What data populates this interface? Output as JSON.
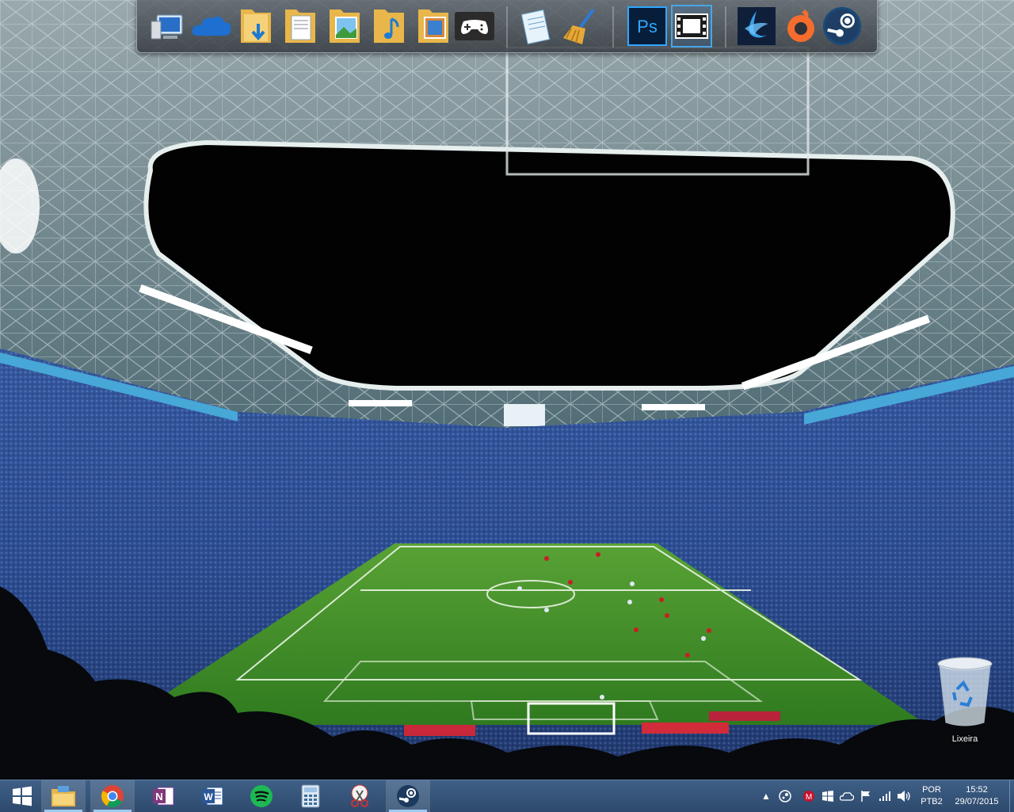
{
  "desktop": {
    "wallpaper": "stadium-night-icon",
    "recycle_bin_label": "Lixeira"
  },
  "dock": {
    "items": [
      {
        "name": "computer-icon"
      },
      {
        "name": "onedrive-cloud-icon"
      },
      {
        "name": "downloads-folder-icon"
      },
      {
        "name": "documents-folder-icon"
      },
      {
        "name": "pictures-folder-icon"
      },
      {
        "name": "music-folder-icon"
      },
      {
        "name": "videos-folder-icon"
      },
      {
        "name": "gamepad-icon"
      },
      {
        "name": "notepad-icon"
      },
      {
        "name": "ccleaner-broom-icon"
      },
      {
        "name": "photoshop-icon",
        "text": "Ps"
      },
      {
        "name": "video-editor-film-icon"
      },
      {
        "name": "battle-net-icon"
      },
      {
        "name": "origin-icon"
      },
      {
        "name": "steam-icon"
      }
    ]
  },
  "taskbar": {
    "pinned": [
      {
        "name": "start-button"
      },
      {
        "name": "file-explorer-icon"
      },
      {
        "name": "chrome-icon"
      },
      {
        "name": "onenote-icon",
        "text": "N"
      },
      {
        "name": "word-icon",
        "text": "W"
      },
      {
        "name": "spotify-icon"
      },
      {
        "name": "calculator-icon"
      },
      {
        "name": "snipping-tool-icon"
      },
      {
        "name": "steam-taskbar-icon"
      }
    ],
    "tray": {
      "language_line1": "POR",
      "language_line2": "PTB2",
      "time": "15:52",
      "date": "29/07/2015"
    }
  },
  "colors": {
    "taskbar": "#2d4a6d",
    "accent": "#4aa6e6",
    "pitch": "#3e8a2a"
  }
}
